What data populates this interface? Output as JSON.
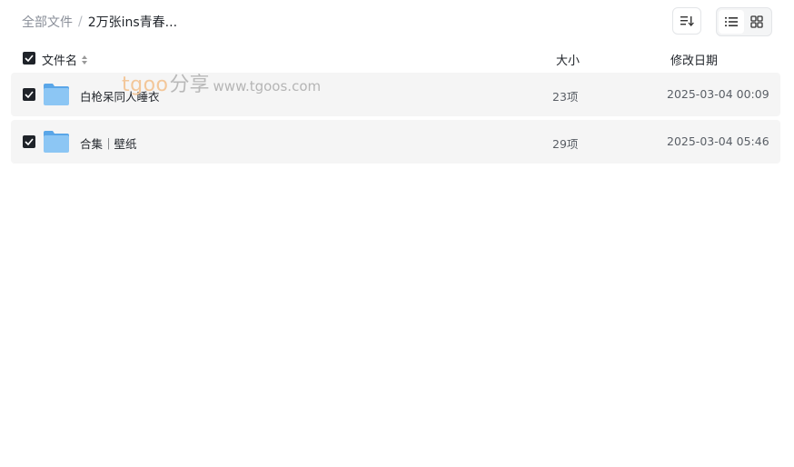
{
  "breadcrumb": {
    "root": "全部文件",
    "separator": "/",
    "current": "2万张ins青春..."
  },
  "toolbar": {
    "sort_icon": "sort-list-icon",
    "view_list_icon": "list-view-icon",
    "view_grid_icon": "grid-view-icon",
    "active_view": "list"
  },
  "table": {
    "headers": {
      "name": "文件名",
      "size": "大小",
      "date": "修改日期"
    },
    "rows": [
      {
        "name": "白枪呆同人睡衣",
        "size": "23项",
        "date": "2025-03-04 00:09",
        "checked": true,
        "icon": "folder-icon"
      },
      {
        "name": "合集｜壁纸",
        "size": "29项",
        "date": "2025-03-04 05:46",
        "checked": true,
        "icon": "folder-icon"
      }
    ]
  },
  "watermark": {
    "logo": "tgoo",
    "cn": "分享",
    "url": "www.tgoos.com"
  },
  "colors": {
    "row_bg": "#f5f5f5",
    "checkbox": "#1f2329",
    "folder": "#7dbdf0"
  }
}
